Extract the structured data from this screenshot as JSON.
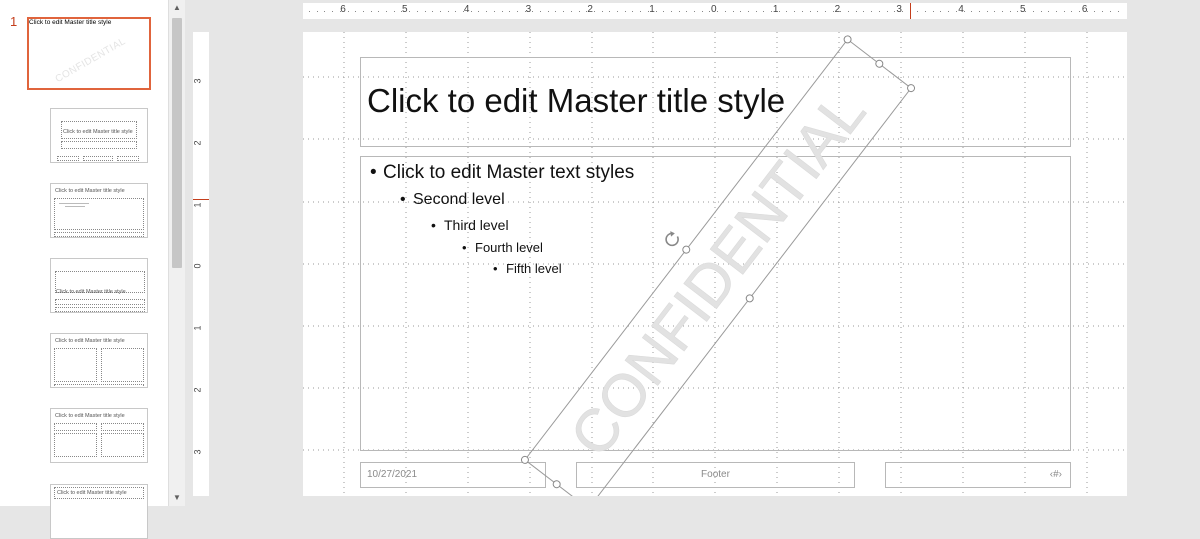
{
  "thumbnails": {
    "slide_number": "1",
    "master_title": "Click to edit Master title style",
    "layouts": [
      {
        "title": "Click to edit Master title style"
      },
      {
        "title": "Click to edit Master title style"
      },
      {
        "title": "Click to edit Master title style"
      },
      {
        "title": "Click to edit Master title style"
      },
      {
        "title": "Click to edit Master title style"
      },
      {
        "title": "Click to edit Master title style"
      }
    ]
  },
  "ruler": {
    "horizontal_labels": [
      "6",
      "5",
      "4",
      "3",
      "2",
      "1",
      "0",
      "1",
      "2",
      "3",
      "4",
      "5",
      "6"
    ],
    "vertical_labels": [
      "3",
      "2",
      "1",
      "0",
      "1",
      "2",
      "3"
    ]
  },
  "slide": {
    "title": "Click to edit Master title style",
    "levels": [
      "Click to edit Master text styles",
      "Second level",
      "Third level",
      "Fourth level",
      "Fifth level"
    ],
    "date": "10/27/2021",
    "footer": "Footer",
    "slide_number": "‹#›",
    "watermark": "CONFIDENTIAL"
  },
  "colors": {
    "selection_accent": "#e0643c",
    "ruler_marker": "#c43e1c",
    "watermark": "#e2e2e2"
  },
  "icons": {
    "scroll_up": "triangle-up",
    "scroll_down": "triangle-down",
    "rotate_handle": "rotate-arrow"
  }
}
